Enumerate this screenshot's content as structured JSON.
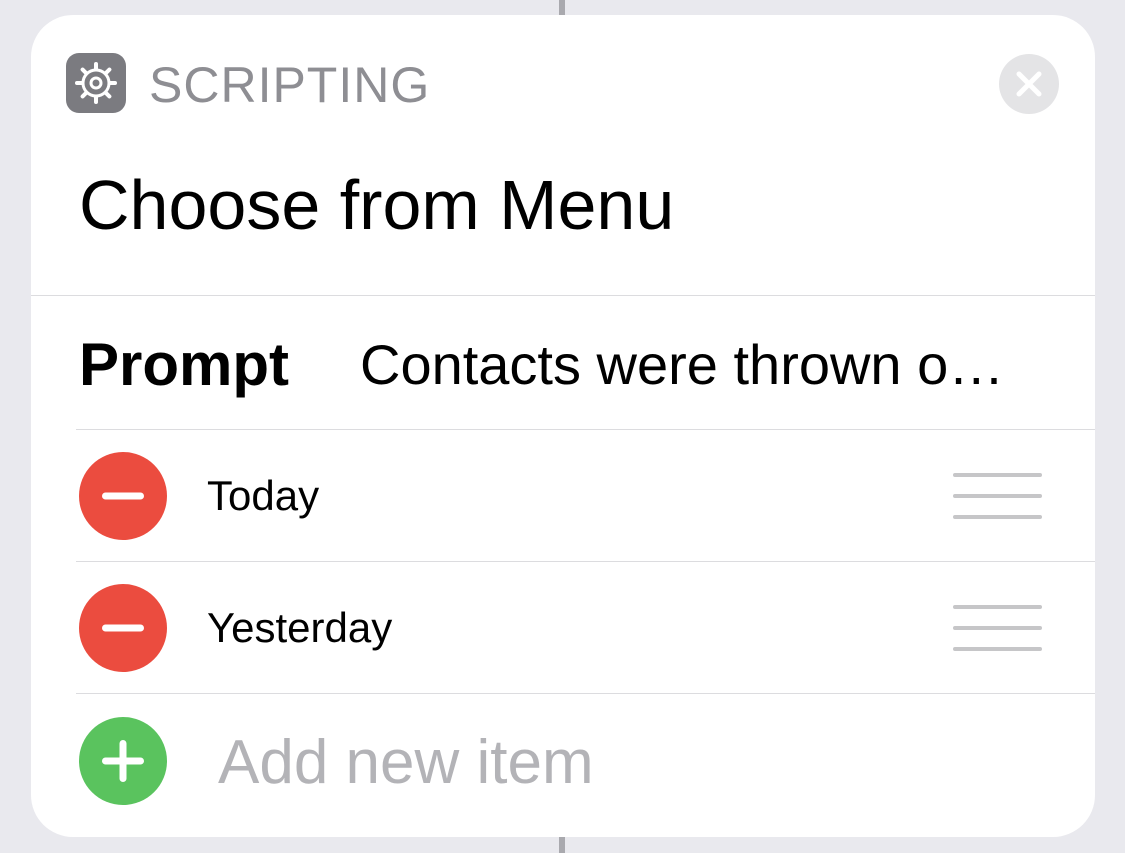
{
  "header": {
    "category": "SCRIPTING",
    "app_icon": "gear-icon",
    "close_icon": "close-icon"
  },
  "action": {
    "title": "Choose from Menu"
  },
  "prompt": {
    "label": "Prompt",
    "value": "Contacts were thrown o…"
  },
  "menu_items": [
    {
      "label": "Today",
      "remove_icon": "minus-circle-icon",
      "handle_icon": "drag-handle-icon"
    },
    {
      "label": "Yesterday",
      "remove_icon": "minus-circle-icon",
      "handle_icon": "drag-handle-icon"
    }
  ],
  "add_item": {
    "placeholder": "Add new item",
    "icon": "plus-circle-icon"
  },
  "colors": {
    "background": "#e9e9ee",
    "card": "#ffffff",
    "icon_gray": "#7b7b80",
    "remove_red": "#eb4c3f",
    "add_green": "#5ac35e",
    "secondary_text": "#8e8e93",
    "placeholder_text": "#b3b3b7"
  }
}
